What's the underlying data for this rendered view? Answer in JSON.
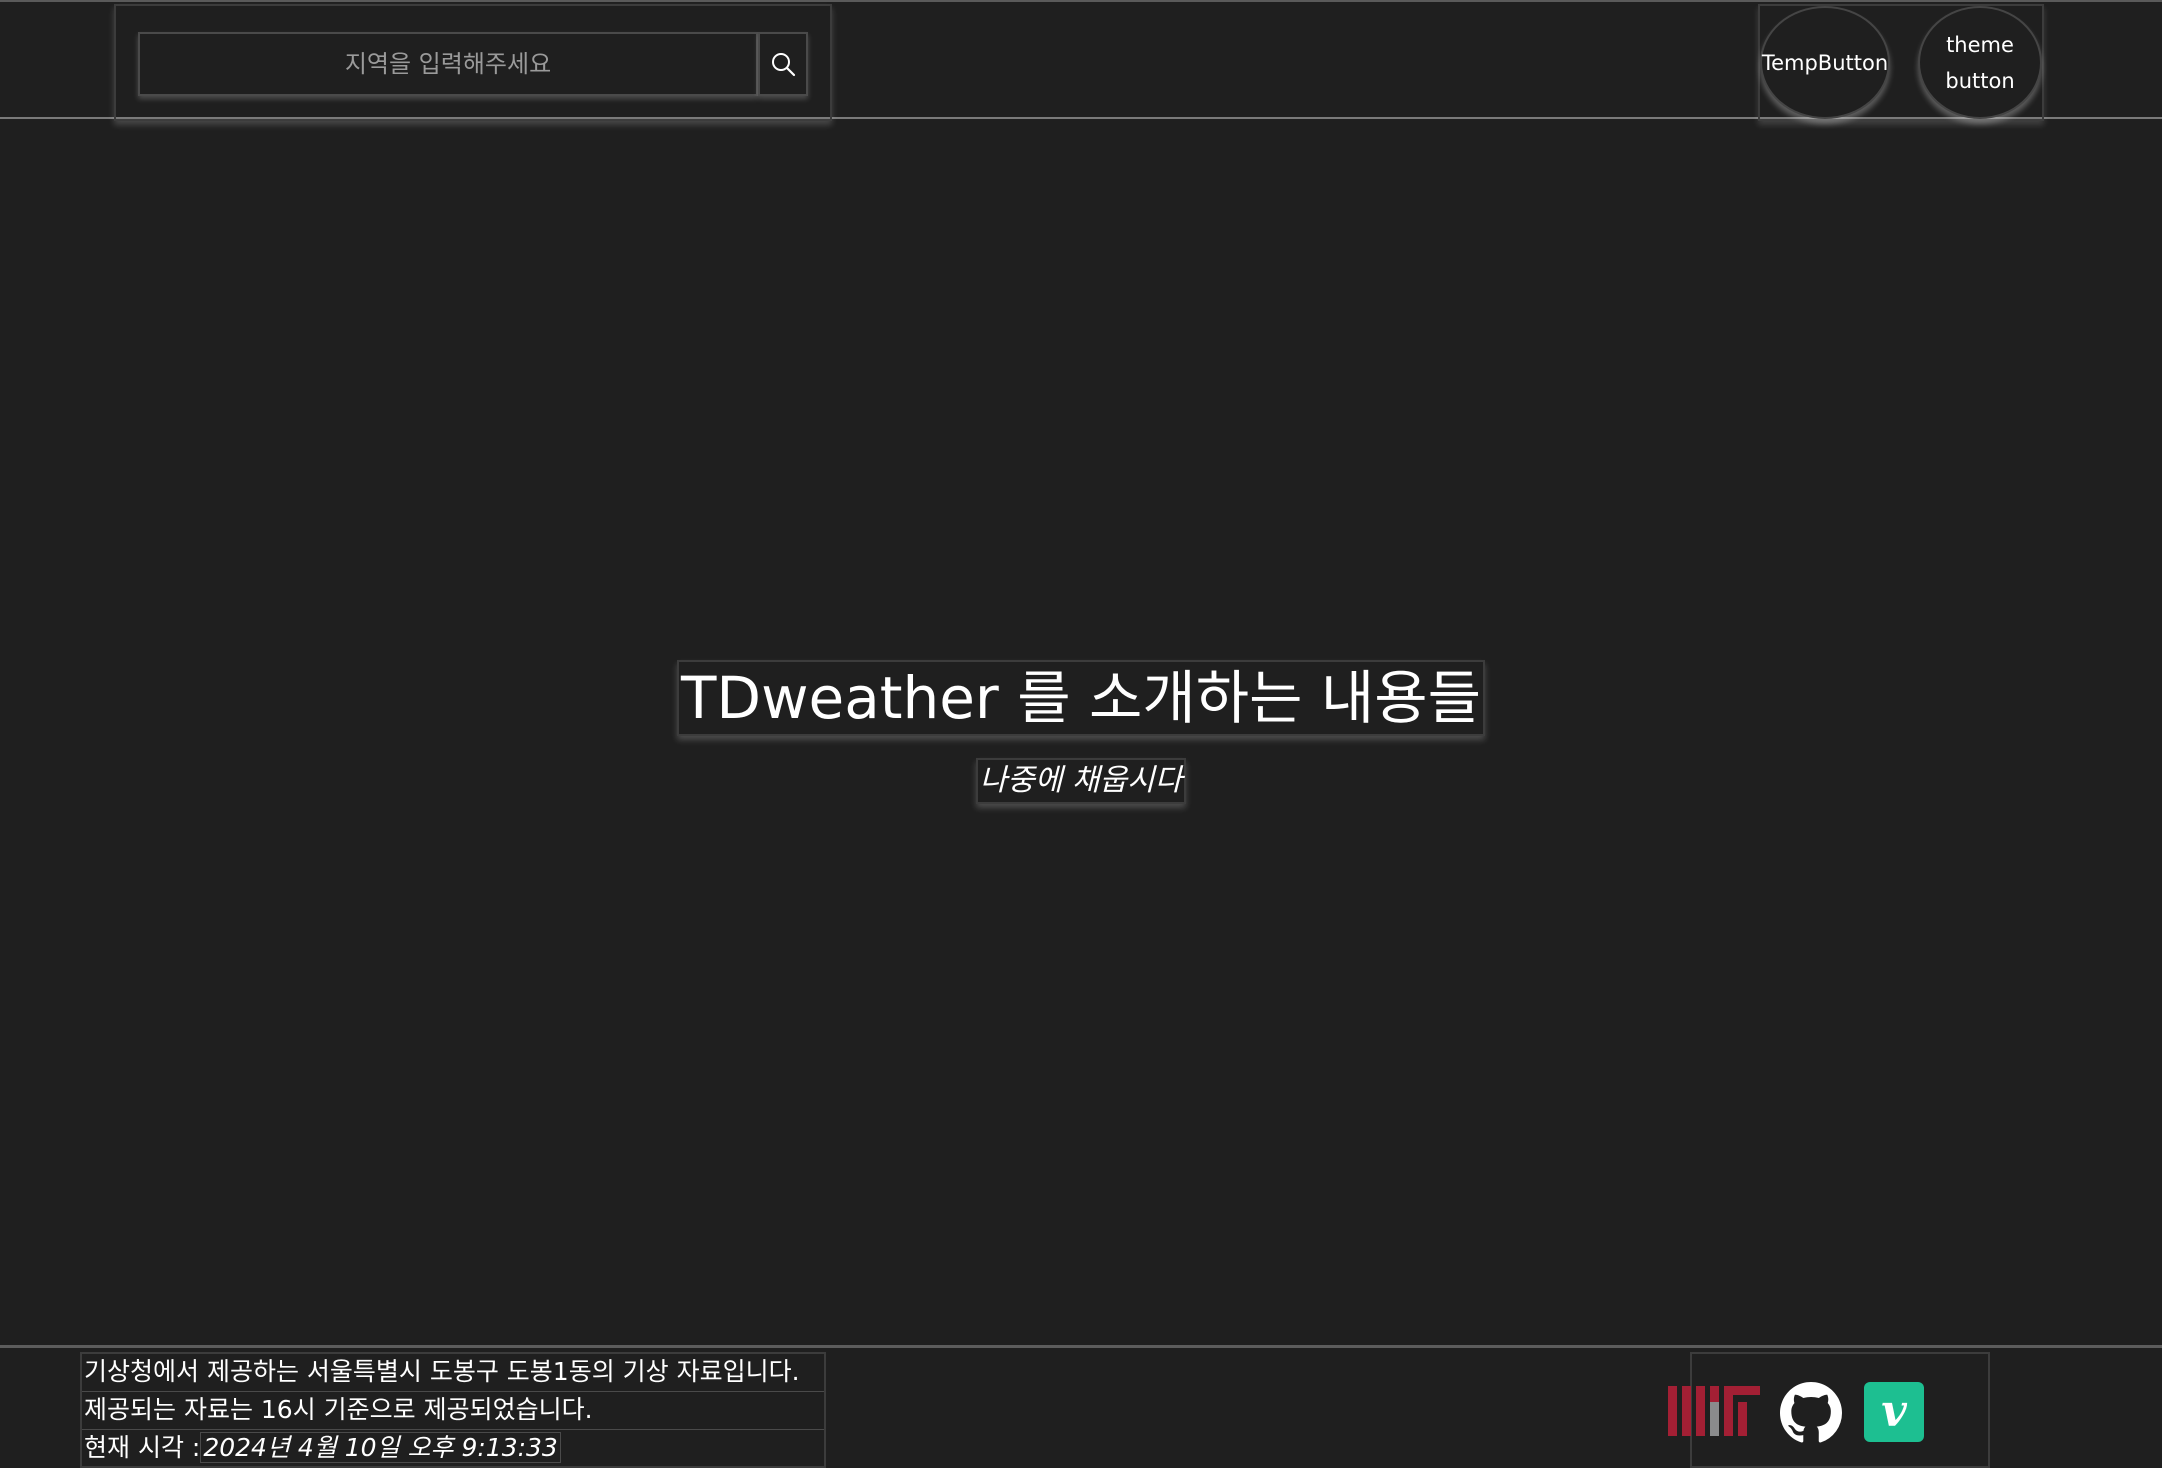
{
  "header": {
    "search": {
      "placeholder": "지역을 입력해주세요",
      "value": ""
    },
    "temp_button_label": "TempButton",
    "theme_button_label": "theme button"
  },
  "hero": {
    "title": "TDweather 를 소개하는 내용들",
    "subtitle": "나중에 채웁시다"
  },
  "footer": {
    "line1": "기상청에서 제공하는 서울특별시 도봉구 도봉1동의 기상 자료입니다.",
    "line2": "제공되는 자료는 16시 기준으로 제공되었습니다.",
    "time_label": "현재 시각 :",
    "time_value": "2024년 4월 10일 오후 9:13:33",
    "icons": [
      "mit-logo-icon",
      "github-icon",
      "vimeo-icon"
    ],
    "colors": {
      "mit_red": "#a31f34",
      "mit_gray": "#8a8b8c",
      "vimeo_green": "#1dbf91"
    }
  },
  "theme": {
    "background": "#1f1f1f",
    "text": "#ffffff"
  }
}
